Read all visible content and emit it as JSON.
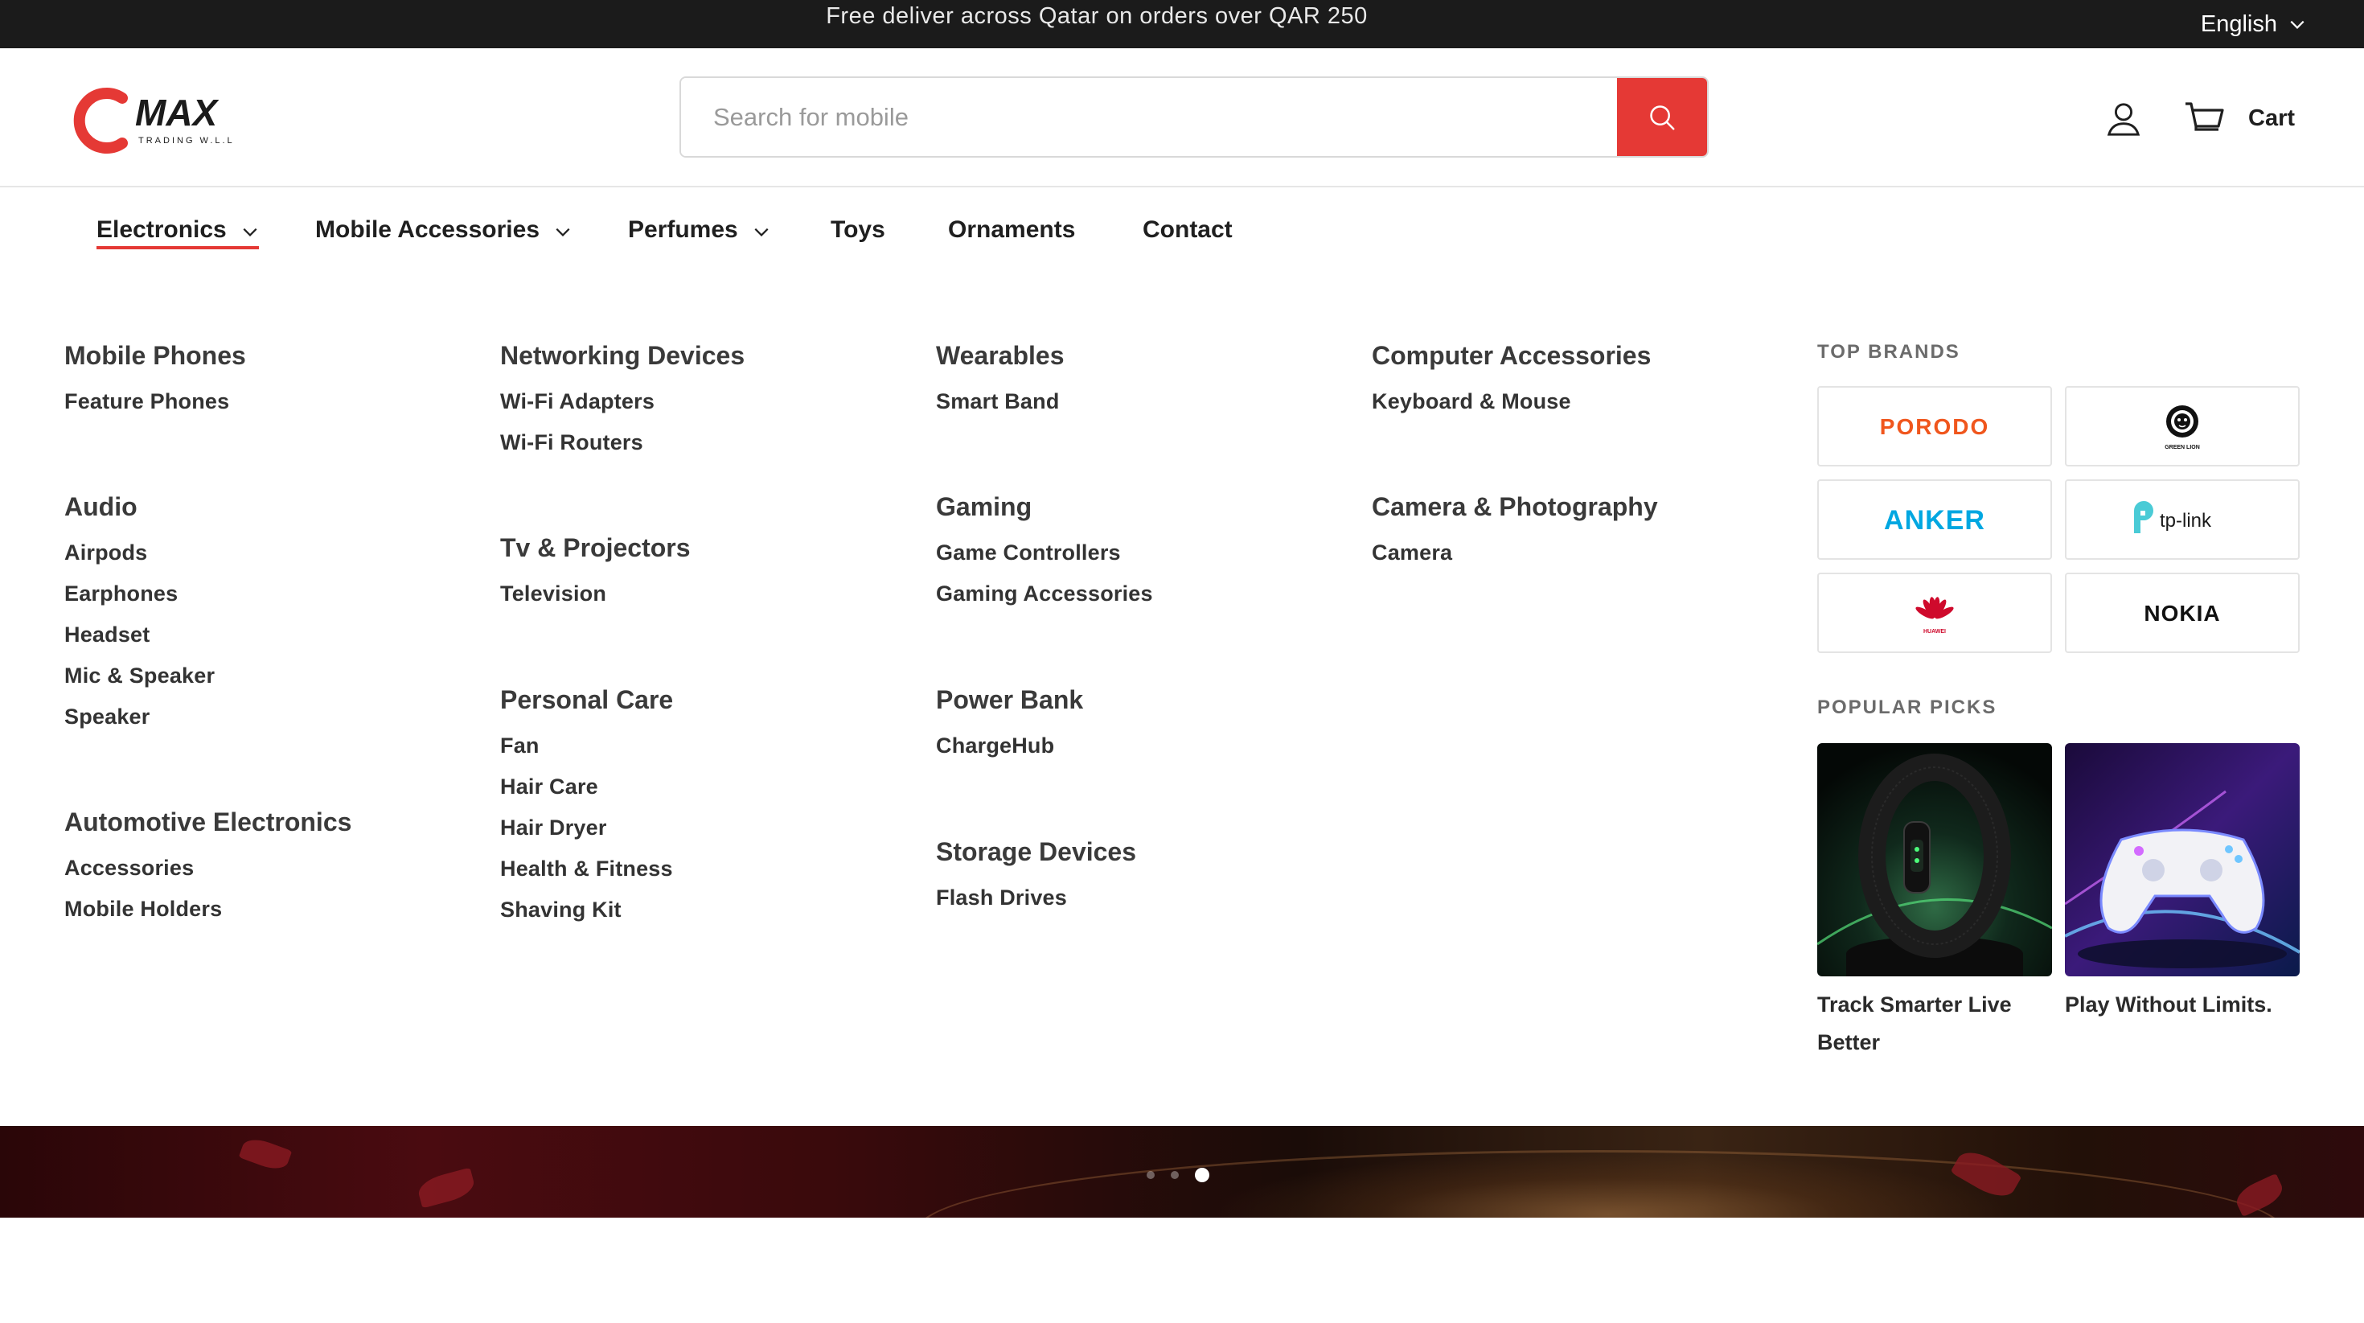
{
  "announcement": {
    "text": "Free deliver across Qatar on orders over QAR 250",
    "language": "English"
  },
  "brand": {
    "name": "MAX",
    "tagline": "TRADING W.L.L",
    "accent_color": "#e53935"
  },
  "search": {
    "placeholder": "Search for mobile"
  },
  "header": {
    "cart_label": "Cart"
  },
  "nav": {
    "items": [
      {
        "label": "Electronics",
        "has_dropdown": true,
        "active": true
      },
      {
        "label": "Mobile Accessories",
        "has_dropdown": true
      },
      {
        "label": "Perfumes",
        "has_dropdown": true
      },
      {
        "label": "Toys",
        "has_dropdown": false
      },
      {
        "label": "Ornaments",
        "has_dropdown": false
      },
      {
        "label": "Contact",
        "has_dropdown": false
      }
    ]
  },
  "mega": {
    "columns": [
      {
        "groups": [
          {
            "title": "Mobile Phones",
            "links": [
              "Feature Phones"
            ]
          },
          {
            "title": "Audio",
            "links": [
              "Airpods",
              "Earphones",
              "Headset",
              "Mic & Speaker",
              "Speaker"
            ]
          },
          {
            "title": "Automotive Electronics",
            "links": [
              "Accessories",
              "Mobile Holders"
            ]
          }
        ]
      },
      {
        "groups": [
          {
            "title": "Networking Devices",
            "links": [
              "Wi-Fi Adapters",
              "Wi-Fi Routers"
            ]
          },
          {
            "title": "Tv & Projectors",
            "links": [
              "Television"
            ]
          },
          {
            "title": "Personal Care",
            "links": [
              "Fan",
              "Hair Care",
              "Hair Dryer",
              "Health & Fitness",
              "Shaving Kit"
            ]
          }
        ]
      },
      {
        "groups": [
          {
            "title": "Wearables",
            "links": [
              "Smart Band"
            ]
          },
          {
            "title": "Gaming",
            "links": [
              "Game Controllers",
              "Gaming Accessories"
            ]
          },
          {
            "title": "Power Bank",
            "links": [
              "ChargeHub"
            ]
          },
          {
            "title": "Storage Devices",
            "links": [
              "Flash Drives"
            ]
          }
        ]
      },
      {
        "groups": [
          {
            "title": "Computer Accessories",
            "links": [
              "Keyboard & Mouse"
            ]
          },
          {
            "title": "Camera & Photography",
            "links": [
              "Camera"
            ]
          }
        ]
      }
    ],
    "top_brands_heading": "TOP BRANDS",
    "brands": [
      {
        "name": "PORODO",
        "color": "#f0561d"
      },
      {
        "name": "GREEN LION",
        "color": "#111111"
      },
      {
        "name": "ANKER",
        "color": "#00a7e1"
      },
      {
        "name": "tp-link",
        "color": "#4acbd6"
      },
      {
        "name": "HUAWEI",
        "color": "#cf0a2c"
      },
      {
        "name": "NOKIA",
        "color": "#111111"
      }
    ],
    "popular_heading": "POPULAR PICKS",
    "picks": [
      {
        "caption": "Track Smarter Live Better",
        "image": "fitness-band"
      },
      {
        "caption": "Play Without Limits.",
        "image": "game-controller"
      }
    ]
  },
  "carousel": {
    "slides": 3,
    "active_slide": 3
  }
}
